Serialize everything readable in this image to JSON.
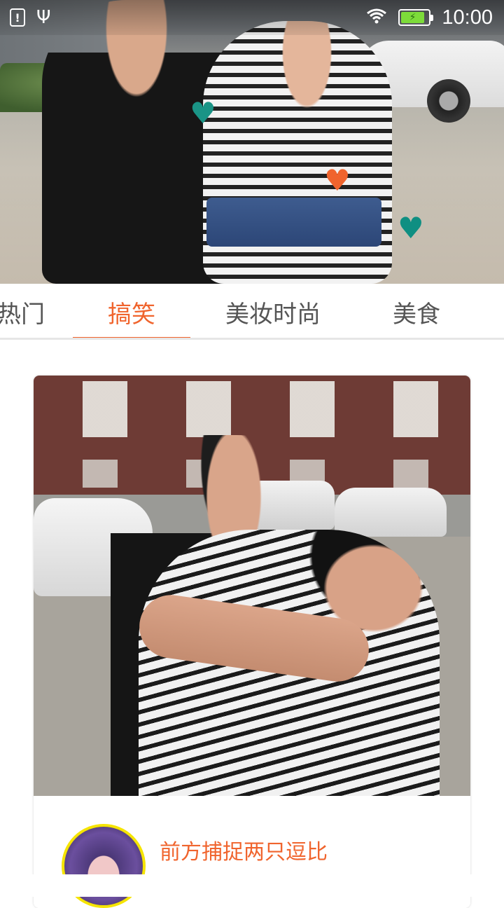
{
  "status_bar": {
    "time": "10:00",
    "icons": [
      "alert-icon",
      "usb-icon",
      "wifi-icon",
      "battery-charging-icon"
    ],
    "battery_level": 0.85,
    "battery_color": "#7ddc3a"
  },
  "hero": {
    "hearts": [
      {
        "icon": "heart-icon",
        "color": "#1a9486"
      },
      {
        "icon": "heart-icon",
        "color": "#f0642d"
      },
      {
        "icon": "heart-icon",
        "color": "#0f8f82"
      }
    ]
  },
  "tabs": {
    "items": [
      {
        "label": "热门"
      },
      {
        "label": "搞笑"
      },
      {
        "label": "美妆时尚"
      },
      {
        "label": "美食"
      }
    ],
    "active_index": 1,
    "accent_color": "#f0642d"
  },
  "feed": {
    "cards": [
      {
        "title": "前方捕捉两只逗比",
        "subtitle": "",
        "avatar": "avatar-image"
      }
    ]
  }
}
